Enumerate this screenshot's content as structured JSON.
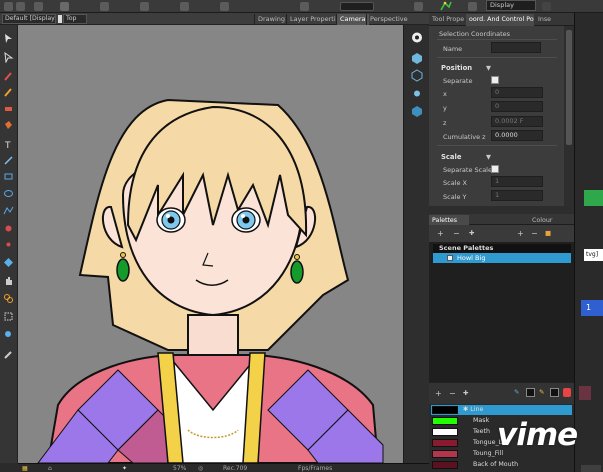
{
  "topbar": {
    "display_select": "Display"
  },
  "viewheader": {
    "view_select": "Default [Display]",
    "camera_select": "Top",
    "tabs": [
      "Drawing",
      "Layer Properties",
      "Camera",
      "Perspective"
    ],
    "active_tab": "Camera"
  },
  "toolprops": {
    "tabs": [
      "Tool Prope",
      "oord. And Control Poi",
      "Inse"
    ],
    "section_title": "Selection Coordinates",
    "name_label": "Name",
    "position_label": "Position",
    "separate_label": "Separate",
    "x_label": "x",
    "x_value": "0",
    "y_label": "y",
    "y_value": "0",
    "z_label": "z",
    "z_value": "0.0002 F",
    "cumulative_label": "Cumulative z",
    "cumulative_value": "0.0000",
    "scale_label": "Scale",
    "separate_scale_label": "Separate Scale",
    "scale_x_label": "Scale X",
    "scale_x_value": "1",
    "scale_y_label": "Scale Y",
    "scale_y_value": "1"
  },
  "palettes": {
    "tab_left": "Palettes",
    "tab_right": "Colour",
    "scene_palettes_label": "Scene Palettes",
    "palette_name": "Howl Big"
  },
  "swatches": [
    {
      "name": "Line",
      "color": "#000000"
    },
    {
      "name": "Mask",
      "color": "#21ff00"
    },
    {
      "name": "Teeth",
      "color": "#ffffff"
    },
    {
      "name": "Tongue_Li",
      "color": "#8a1a2e"
    },
    {
      "name": "Toung_Fill",
      "color": "#b3364f"
    },
    {
      "name": "Back of Mouth",
      "color": "#5c1120"
    }
  ],
  "statusbar": {
    "zoom": "57%",
    "colorspace": "Rec.709",
    "fps_label": "Fps/Frames"
  },
  "farright": {
    "tvg_label": "tvg]",
    "number": "1"
  },
  "watermark": "vime"
}
